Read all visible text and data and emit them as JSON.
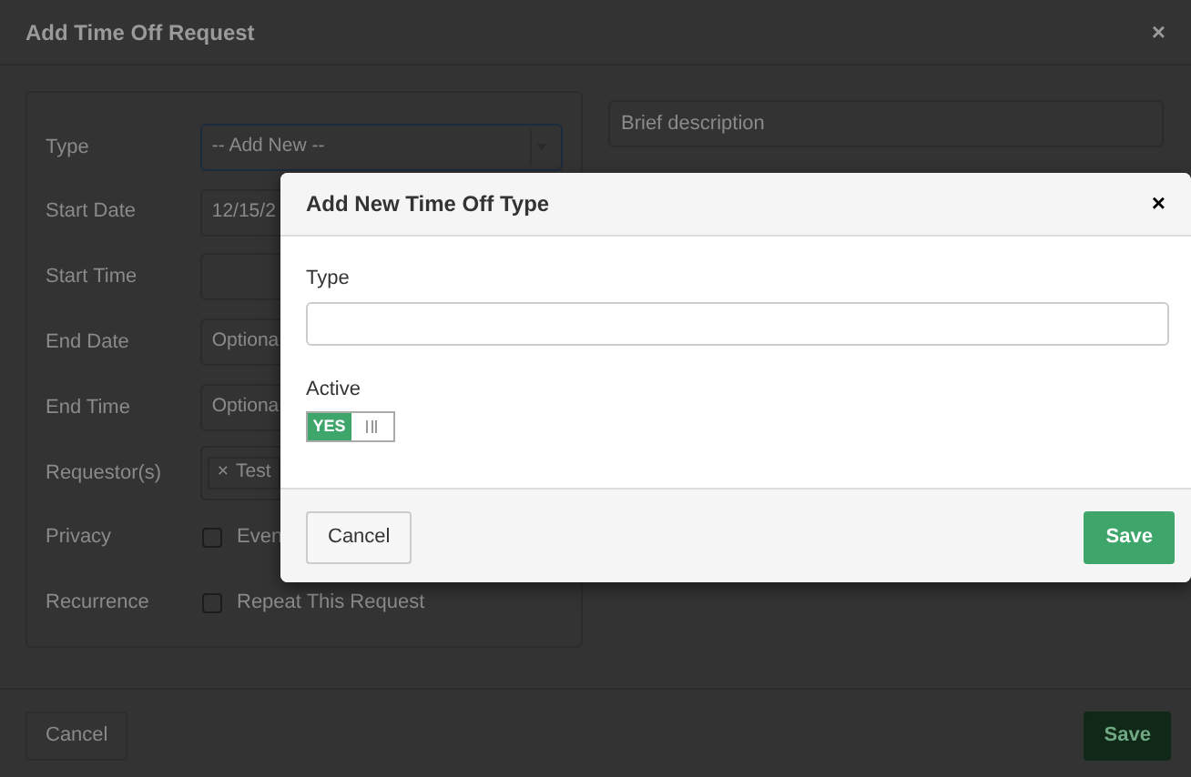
{
  "request_dialog": {
    "title": "Add Time Off Request",
    "close": "×",
    "fields": [
      {
        "kind": "select",
        "label": "Type",
        "value": "-- Add New --"
      },
      {
        "kind": "text",
        "label": "Start Date",
        "value": "12/15/2"
      },
      {
        "kind": "text",
        "label": "Start Time"
      },
      {
        "kind": "placeholder",
        "label": "End Date",
        "placeholder": "Optiona"
      },
      {
        "kind": "placeholder",
        "label": "End Time",
        "placeholder": "Optiona"
      },
      {
        "kind": "tags",
        "label": "Requestor(s)",
        "tags": [
          {
            "remove": "×",
            "text": "Test"
          }
        ]
      },
      {
        "kind": "checkbox",
        "label": "Privacy",
        "text": "Even",
        "checked": false
      },
      {
        "kind": "checkbox",
        "label": "Recurrence",
        "text": "Repeat This Request",
        "checked": false
      }
    ],
    "description": {
      "placeholder": "Brief description"
    },
    "buttons": [
      {
        "kind": "default",
        "label": "Cancel"
      },
      {
        "kind": "primary",
        "label": "Save"
      }
    ]
  },
  "type_dialog": {
    "title": "Add New Time Off Type",
    "close": "×",
    "type_field": {
      "label": "Type"
    },
    "active": {
      "label": "Active",
      "toggle_text": "YES",
      "on": true
    },
    "buttons": [
      {
        "kind": "default",
        "label": "Cancel"
      },
      {
        "kind": "primary",
        "label": "Save"
      }
    ]
  }
}
